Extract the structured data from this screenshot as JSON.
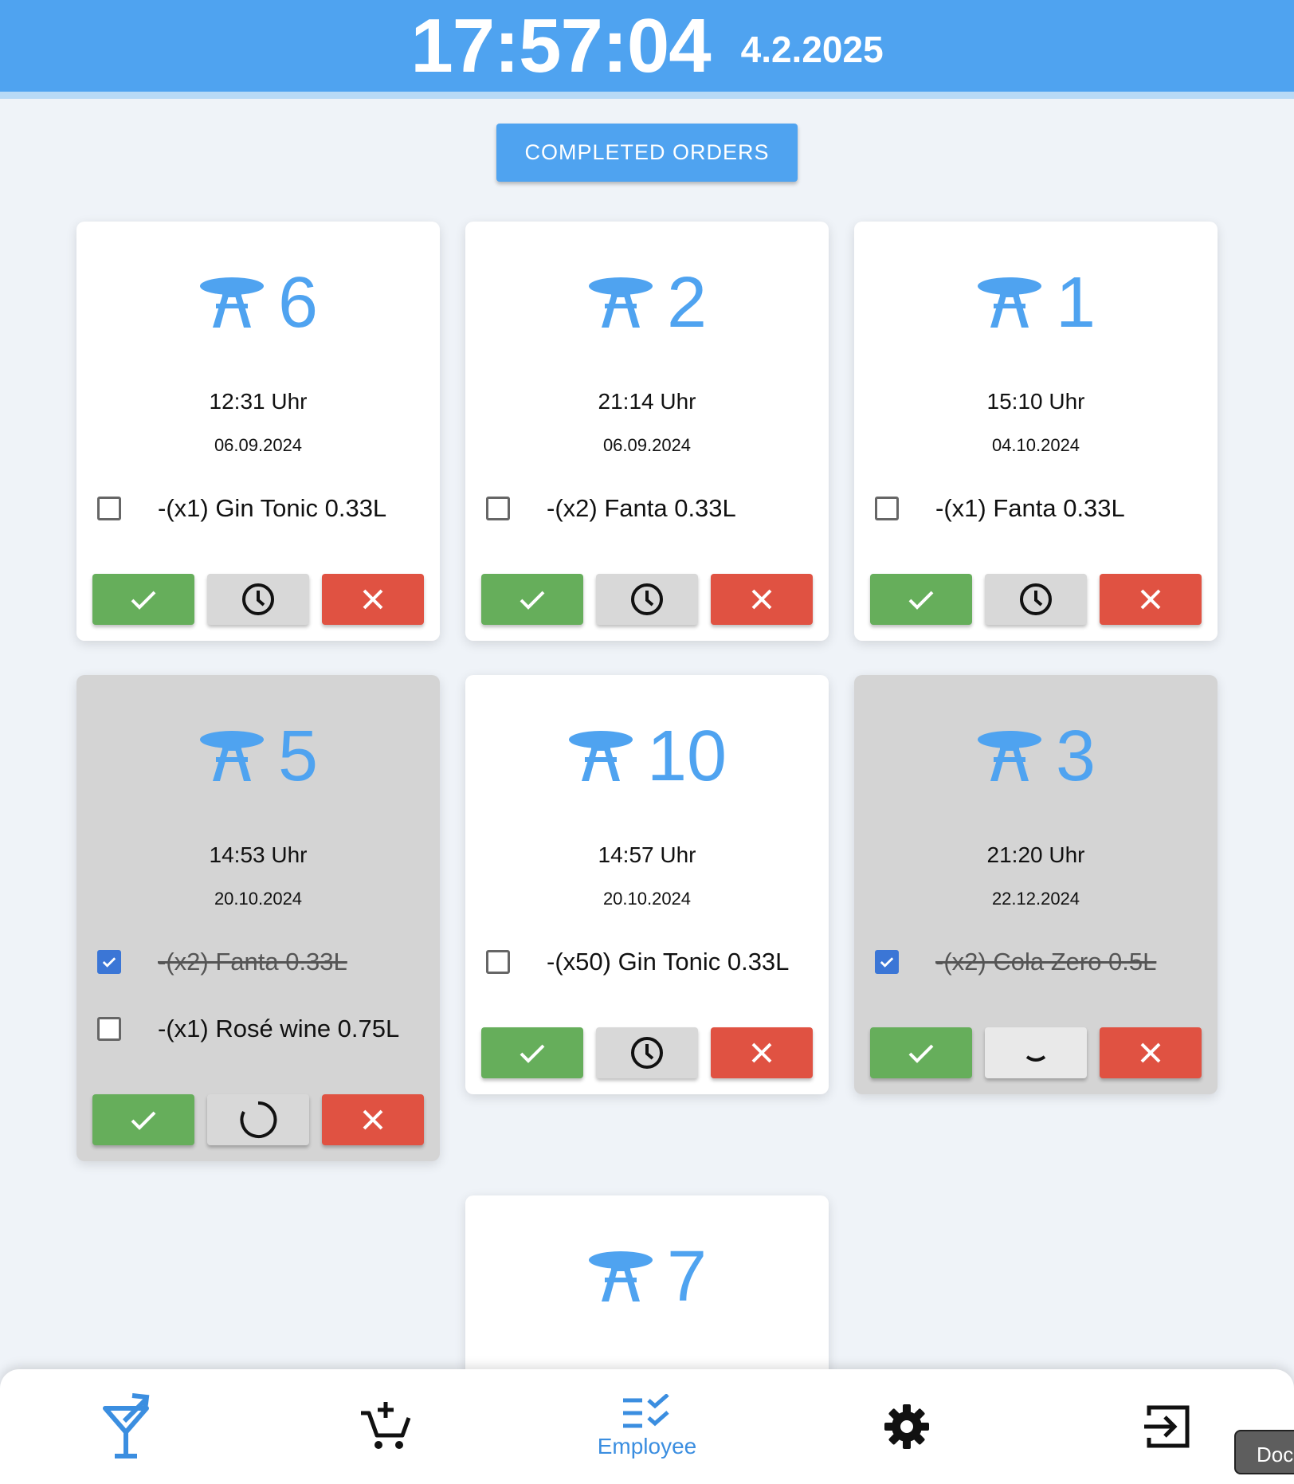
{
  "header": {
    "time": "17:57:04",
    "date": "4.2.2025",
    "bar_color": "#4fa3f0"
  },
  "completed_button": {
    "label": "COMPLETED ORDERS"
  },
  "cards": [
    {
      "table": "6",
      "time": "12:31 Uhr",
      "date": "06.09.2024",
      "dimmed": false,
      "wait_state": "clock",
      "items": [
        {
          "label": "-(x1) Gin Tonic 0.33L",
          "checked": false
        }
      ]
    },
    {
      "table": "2",
      "time": "21:14 Uhr",
      "date": "06.09.2024",
      "dimmed": false,
      "wait_state": "clock",
      "items": [
        {
          "label": "-(x2) Fanta 0.33L",
          "checked": false
        }
      ]
    },
    {
      "table": "1",
      "time": "15:10 Uhr",
      "date": "04.10.2024",
      "dimmed": false,
      "wait_state": "clock",
      "items": [
        {
          "label": "-(x1) Fanta 0.33L",
          "checked": false
        }
      ]
    },
    {
      "table": "5",
      "time": "14:53 Uhr",
      "date": "20.10.2024",
      "dimmed": true,
      "wait_state": "spinner",
      "items": [
        {
          "label": "-(x2) Fanta 0.33L",
          "checked": true
        },
        {
          "label": "-(x1) Rosé wine 0.75L",
          "checked": false
        }
      ]
    },
    {
      "table": "10",
      "time": "14:57 Uhr",
      "date": "20.10.2024",
      "dimmed": false,
      "wait_state": "clock",
      "items": [
        {
          "label": "-(x50) Gin Tonic 0.33L",
          "checked": false
        }
      ]
    },
    {
      "table": "3",
      "time": "21:20 Uhr",
      "date": "22.12.2024",
      "dimmed": true,
      "wait_state": "spinner-small",
      "items": [
        {
          "label": "-(x2) Cola Zero 0.5L",
          "checked": true
        }
      ]
    },
    {
      "table": "7"
    }
  ],
  "nav": {
    "items": [
      {
        "icon": "cocktail-icon"
      },
      {
        "icon": "add-to-cart-icon"
      },
      {
        "icon": "checklist-icon",
        "label": "Employee",
        "active": true
      },
      {
        "icon": "gear-icon"
      },
      {
        "icon": "logout-icon"
      }
    ]
  },
  "doc_chip": {
    "label": "Doc"
  },
  "colors": {
    "accent": "#4fa3f0",
    "confirm": "#66ae5b",
    "cancel": "#e05242",
    "checkbox": "#3b76d6"
  }
}
